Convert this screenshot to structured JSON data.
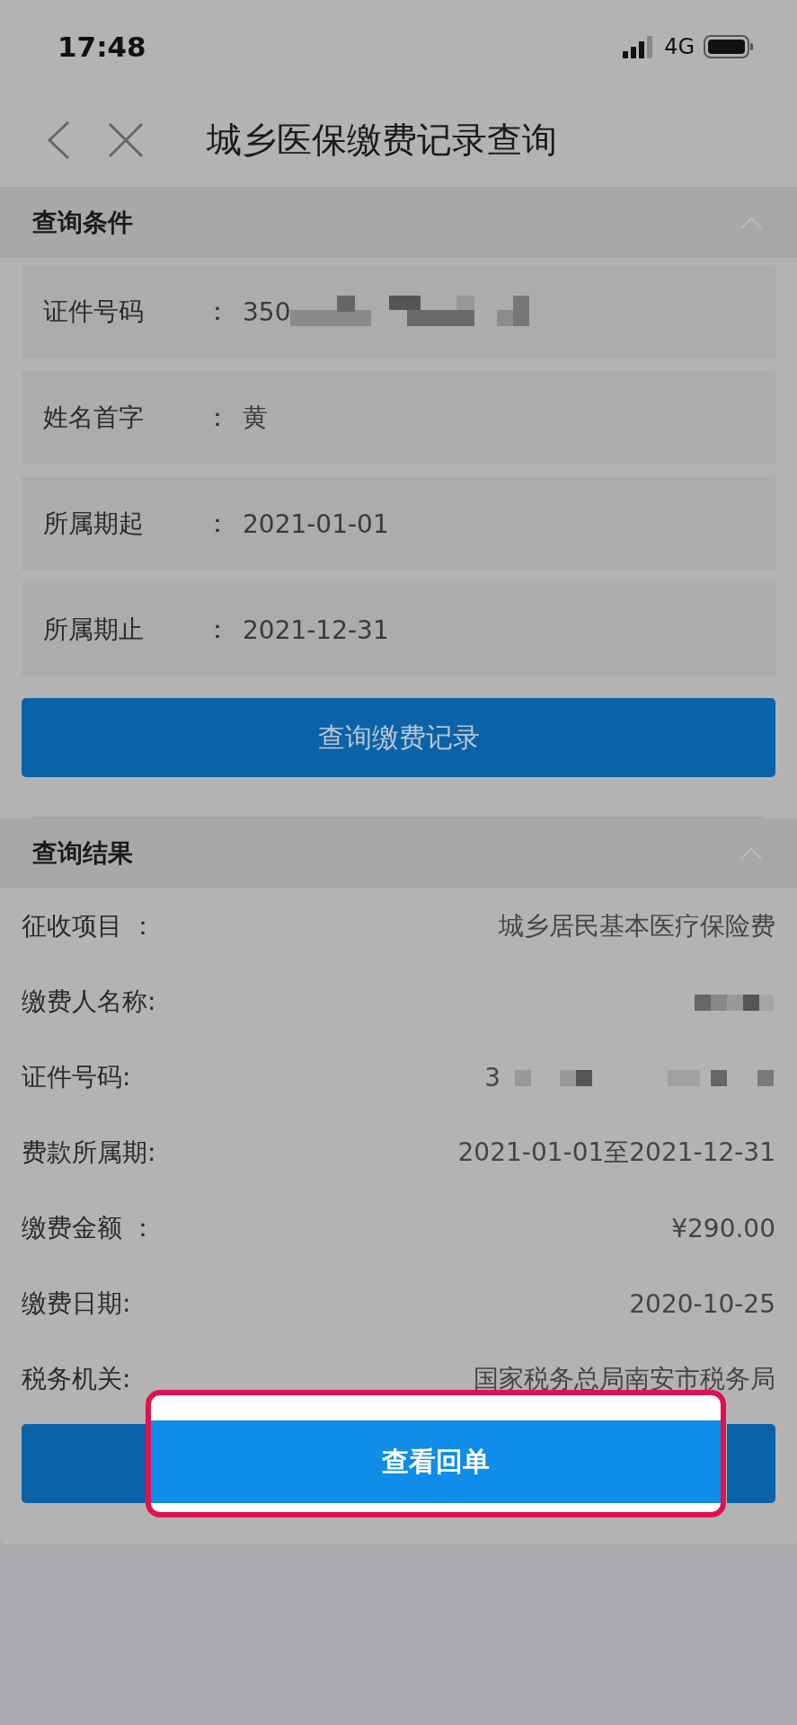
{
  "status_bar": {
    "time": "17:48",
    "network": "4G"
  },
  "nav": {
    "title": "城乡医保缴费记录查询"
  },
  "conditions": {
    "title": "查询条件",
    "expanded": true,
    "fields": [
      {
        "label": "证件号码",
        "colon": "：",
        "value": "350",
        "redacted": true
      },
      {
        "label": "姓名首字",
        "colon": "：",
        "value": "黄",
        "redacted": false
      },
      {
        "label": "所属期起",
        "colon": "：",
        "value": "2021-01-01",
        "redacted": false
      },
      {
        "label": "所属期止",
        "colon": "：",
        "value": "2021-12-31",
        "redacted": false
      }
    ],
    "button": "查询缴费记录"
  },
  "results": {
    "title": "查询结果",
    "expanded": true,
    "rows": [
      {
        "label": "征收项目 ：",
        "value": "城乡居民基本医疗保险费",
        "redacted": false
      },
      {
        "label": "缴费人名称:",
        "value": "",
        "redacted": true
      },
      {
        "label": "证件号码:",
        "value": "3",
        "redacted": true
      },
      {
        "label": "费款所属期:",
        "value": "2021-01-01至2021-12-31",
        "redacted": false
      },
      {
        "label": "缴费金额 ：",
        "value": "¥290.00",
        "redacted": false
      },
      {
        "label": "缴费日期:",
        "value": "2020-10-25",
        "redacted": false
      },
      {
        "label": "税务机关:",
        "value": "国家税务总局南安市税务局",
        "redacted": false
      }
    ],
    "button": "查看回单",
    "highlighted": true
  }
}
